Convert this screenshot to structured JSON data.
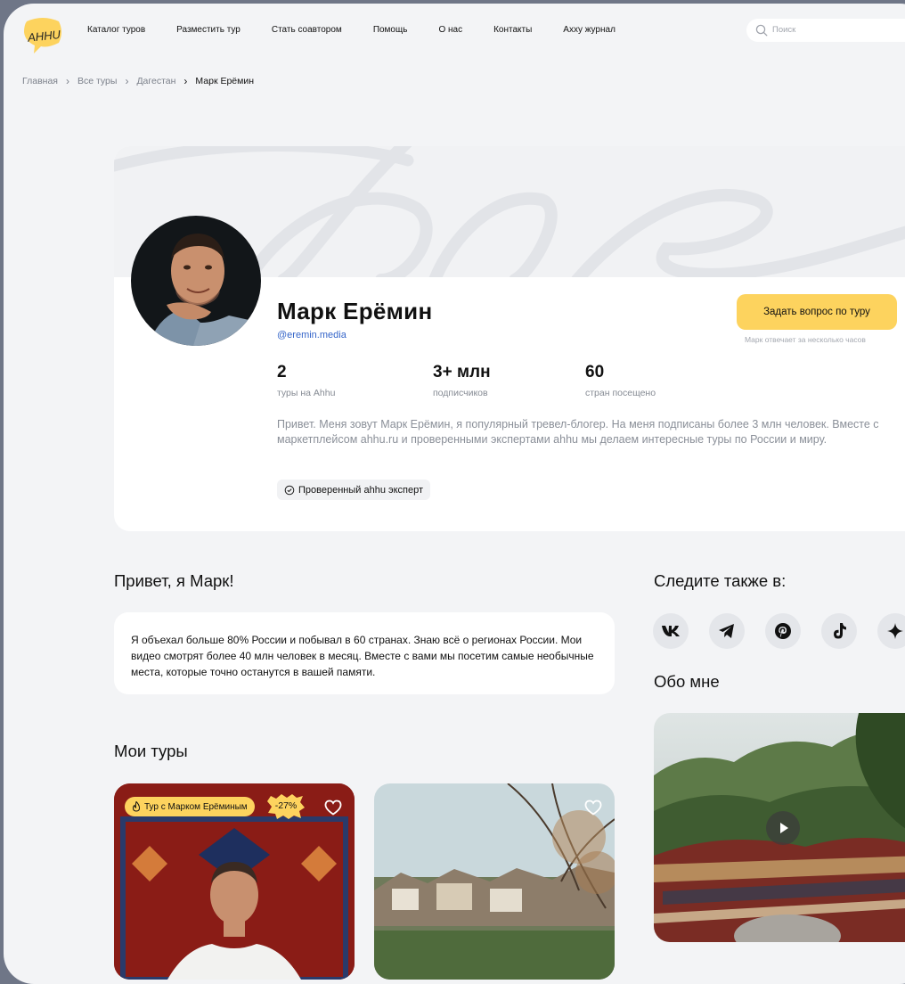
{
  "nav": {
    "logo_text": "AHHU",
    "items": [
      "Каталог туров",
      "Разместить тур",
      "Стать соавтором",
      "Помощь",
      "О нас",
      "Контакты",
      "Ахху журнал"
    ],
    "search_placeholder": "Поиск"
  },
  "breadcrumbs": [
    "Главная",
    "Все туры",
    "Дагестан",
    "Марк Ерёмин"
  ],
  "profile": {
    "name": "Марк Ерёмин",
    "handle": "@eremin.media",
    "ask_button": "Задать вопрос по туру",
    "ask_note": "Марк отвечает за несколько часов",
    "stats": [
      {
        "value": "2",
        "label": "туры на Ahhu"
      },
      {
        "value": "3+ млн",
        "label": "подписчиков"
      },
      {
        "value": "60",
        "label": "стран посещено"
      }
    ],
    "bio": "Привет. Меня зовут Марк Ерёмин, я популярный тревел-блогер. На меня подписаны более 3 млн человек. Вместе с маркетплейсом ahhu.ru и проверенными экспертами ahhu мы делаем интересные туры по России и миру.",
    "verified_badge": "Проверенный ahhu эксперт"
  },
  "greeting": {
    "title": "Привет, я Марк!",
    "text": "Я объехал больше 80% России и побывал в 60 странах. Знаю всё о регионах России. Мои видео смотрят более 40 млн человек в месяц. Вместе с вами мы посетим самые необычные места, которые точно останутся в вашей памяти."
  },
  "follow": {
    "title": "Следите также в:",
    "icons": [
      "vk-icon",
      "telegram-icon",
      "pinterest-icon",
      "tiktok-icon",
      "sparkle-icon"
    ]
  },
  "about": {
    "title": "Обо мне"
  },
  "tours": {
    "title": "Мои туры",
    "items": [
      {
        "tag": "Тур с Марком Ерёминым",
        "discount": "-27%"
      },
      {
        "tag": "",
        "discount": ""
      }
    ]
  },
  "colors": {
    "accent": "#fdd35e",
    "link": "#3565c9",
    "background": "#f3f4f6"
  }
}
